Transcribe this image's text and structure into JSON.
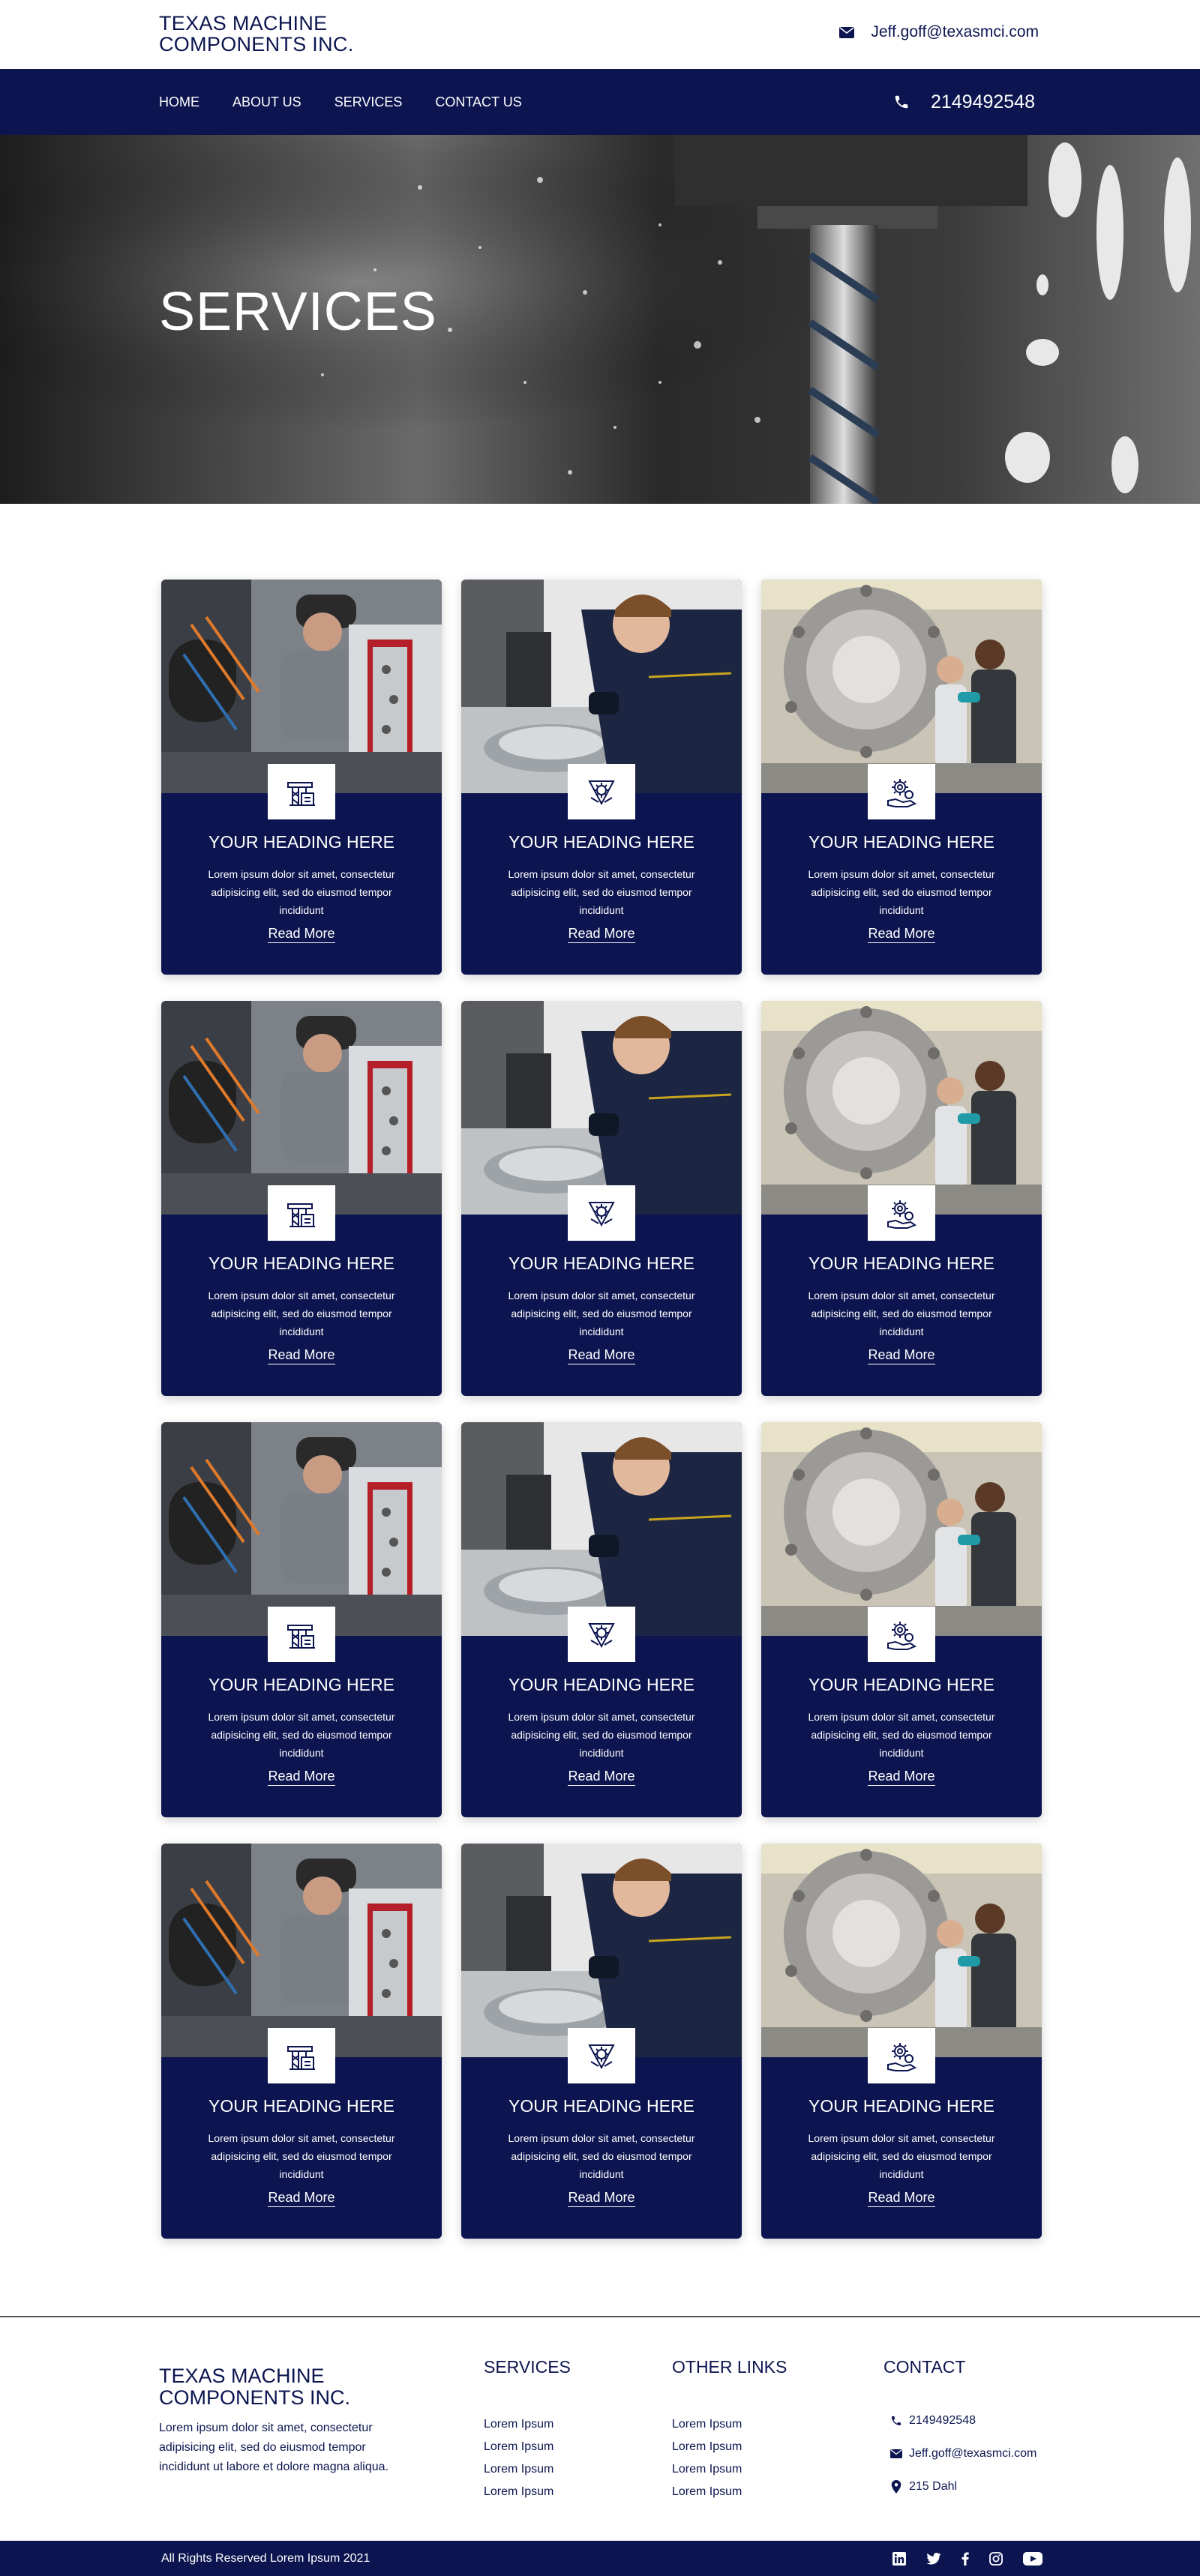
{
  "header": {
    "logo_line1": "TEXAS MACHINE",
    "logo_line2": "COMPONENTS INC.",
    "email": "Jeff.goff@texasmci.com"
  },
  "nav": {
    "items": [
      "HOME",
      "ABOUT US",
      "SERVICES",
      "CONTACT US"
    ],
    "phone": "2149492548"
  },
  "hero": {
    "title": "SERVICES"
  },
  "cards": {
    "heading": "YOUR HEADING HERE",
    "text": "Lorem ipsum dolor sit amet, consectetur adipisicing elit, sed do eiusmod tempor incididunt",
    "link": "Read More",
    "icons": [
      "crane-icon",
      "gear-wrench-icon",
      "gear-hand-icon"
    ]
  },
  "footer": {
    "logo_line1": "TEXAS MACHINE",
    "logo_line2": "COMPONENTS INC.",
    "about": "Lorem ipsum dolor sit amet, consectetur adipisicing elit, sed do eiusmod tempor incididunt ut labore et dolore magna aliqua.",
    "services_title": "SERVICES",
    "services": [
      "Lorem Ipsum",
      "Lorem Ipsum",
      "Lorem Ipsum",
      "Lorem Ipsum"
    ],
    "other_title": "OTHER LINKS",
    "other": [
      "Lorem Ipsum",
      "Lorem Ipsum",
      "Lorem Ipsum",
      "Lorem Ipsum"
    ],
    "contact_title": "CONTACT",
    "phone": "2149492548",
    "email": "Jeff.goff@texasmci.com",
    "address": "215 Dahl",
    "copyright": "All Rights Reserved Lorem Ipsum 2021",
    "socials": [
      "linkedin-icon",
      "twitter-icon",
      "facebook-icon",
      "instagram-icon",
      "youtube-icon"
    ]
  },
  "colors": {
    "brand": "#0c1550",
    "white": "#ffffff"
  }
}
